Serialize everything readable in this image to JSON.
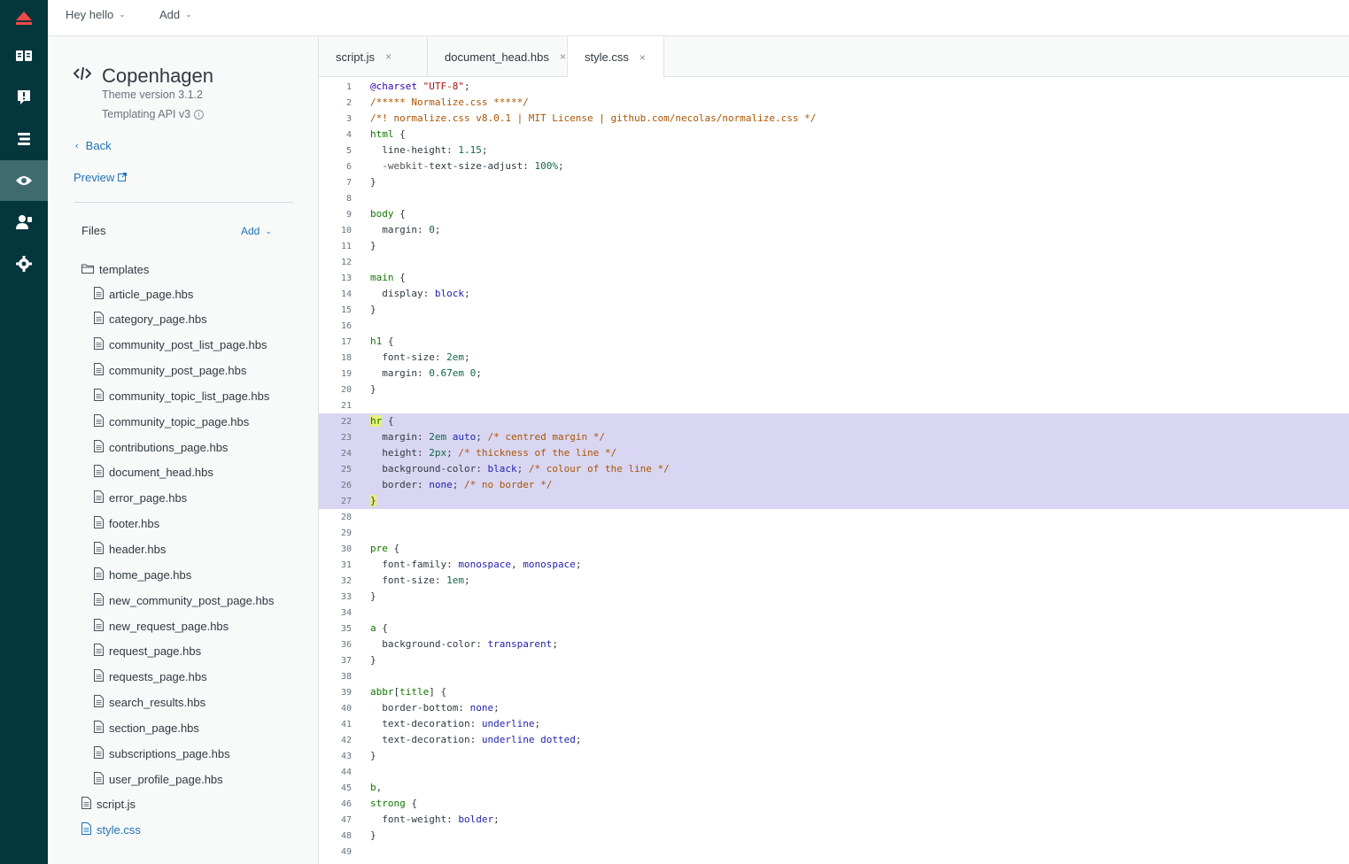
{
  "topbar": {
    "menus": [
      "Hey hello",
      "Add"
    ]
  },
  "rail": {
    "icons": [
      "zendesk-logo-icon",
      "guide-book-icon",
      "feedback-icon",
      "arrange-icon",
      "view-eye-icon",
      "user-permissions-icon",
      "settings-gear-icon"
    ]
  },
  "panel": {
    "theme_name": "Copenhagen",
    "theme_version": "Theme version 3.1.2",
    "templating_api": "Templating API v3",
    "back_label": "Back",
    "preview_label": "Preview",
    "files_label": "Files",
    "files_add_label": "Add",
    "folder_name": "templates",
    "template_files": [
      "article_page.hbs",
      "category_page.hbs",
      "community_post_list_page.hbs",
      "community_post_page.hbs",
      "community_topic_list_page.hbs",
      "community_topic_page.hbs",
      "contributions_page.hbs",
      "document_head.hbs",
      "error_page.hbs",
      "footer.hbs",
      "header.hbs",
      "home_page.hbs",
      "new_community_post_page.hbs",
      "new_request_page.hbs",
      "request_page.hbs",
      "requests_page.hbs",
      "search_results.hbs",
      "section_page.hbs",
      "subscriptions_page.hbs",
      "user_profile_page.hbs"
    ],
    "root_files": [
      "script.js",
      "style.css"
    ],
    "selected_file": "style.css"
  },
  "tabs": [
    {
      "label": "script.js",
      "close": "×"
    },
    {
      "label": "document_head.hbs",
      "close": "×"
    },
    {
      "label": "style.css",
      "close": "×"
    }
  ],
  "active_tab": "style.css",
  "editor": {
    "highlighted_lines": "22-27",
    "lines": [
      "@charset \"UTF-8\";",
      "/***** Normalize.css *****/",
      "/*! normalize.css v8.0.1 | MIT License | github.com/necolas/normalize.css */",
      "html {",
      "  line-height: 1.15;",
      "  -webkit-text-size-adjust: 100%;",
      "}",
      "",
      "body {",
      "  margin: 0;",
      "}",
      "",
      "main {",
      "  display: block;",
      "}",
      "",
      "h1 {",
      "  font-size: 2em;",
      "  margin: 0.67em 0;",
      "}",
      "",
      "hr {",
      "  margin: 2em auto; /* centred margin */",
      "  height: 2px; /* thickness of the line */",
      "  background-color: black; /* colour of the line */",
      "  border: none; /* no border */",
      "}",
      "",
      "",
      "pre {",
      "  font-family: monospace, monospace;",
      "  font-size: 1em;",
      "}",
      "",
      "a {",
      "  background-color: transparent;",
      "}",
      "",
      "abbr[title] {",
      "  border-bottom: none;",
      "  text-decoration: underline;",
      "  text-decoration: underline dotted;",
      "}",
      "",
      "b,",
      "strong {",
      "  font-weight: bolder;",
      "}",
      ""
    ]
  },
  "colors": {
    "rail_bg": "#03363d",
    "rail_active": "#3e6a70",
    "link": "#1f73b7",
    "highlight": "#d9d6f3"
  }
}
